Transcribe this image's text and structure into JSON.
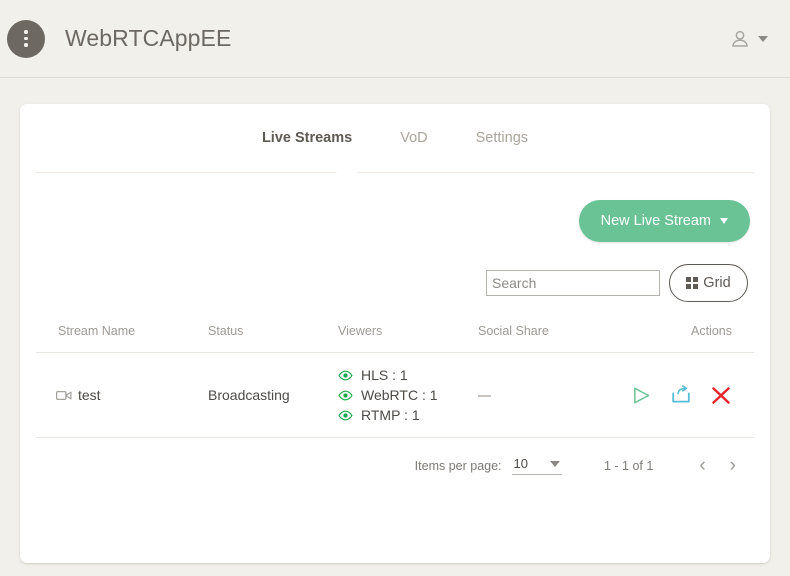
{
  "appbar": {
    "menu_icon": "kebab-menu-icon",
    "title": "WebRTCAppEE",
    "user_icon": "user-account-icon"
  },
  "tabs": [
    {
      "label": "Live Streams",
      "active": true
    },
    {
      "label": "VoD",
      "active": false
    },
    {
      "label": "Settings",
      "active": false
    }
  ],
  "toolbar": {
    "new_stream_label": "New Live Stream",
    "grid_label": "Grid",
    "grid_icon": "grid-view-icon"
  },
  "search": {
    "value": "",
    "placeholder": "Search"
  },
  "table": {
    "headers": {
      "name": "Stream Name",
      "status": "Status",
      "viewers": "Viewers",
      "social": "Social Share",
      "actions": "Actions"
    },
    "rows": [
      {
        "name": "test",
        "name_icon": "videocam-icon",
        "status": "Broadcasting",
        "viewers": [
          {
            "icon": "eye-icon",
            "label": "HLS : 1"
          },
          {
            "icon": "eye-icon",
            "label": "WebRTC : 1"
          },
          {
            "icon": "eye-icon",
            "label": "RTMP : 1"
          }
        ],
        "social": "—",
        "actions": [
          {
            "icon": "play-icon",
            "name": "play-stream-button"
          },
          {
            "icon": "share-icon",
            "name": "share-stream-button"
          },
          {
            "icon": "close-x-icon",
            "name": "delete-stream-button"
          }
        ]
      }
    ]
  },
  "paginator": {
    "items_per_page_label": "Items per page:",
    "items_per_page_value": "10",
    "range_label": "1 - 1 of 1",
    "prev_icon": "chevron-left-icon",
    "next_icon": "chevron-right-icon"
  },
  "colors": {
    "page_background": "#f1f0eb",
    "accent_green": "#6ac395",
    "viewer_green": "#1eaa4b",
    "action_play": "#6ac395",
    "action_share": "#56bcd6",
    "action_delete": "#e8252a",
    "title_gray": "#6d6862"
  }
}
